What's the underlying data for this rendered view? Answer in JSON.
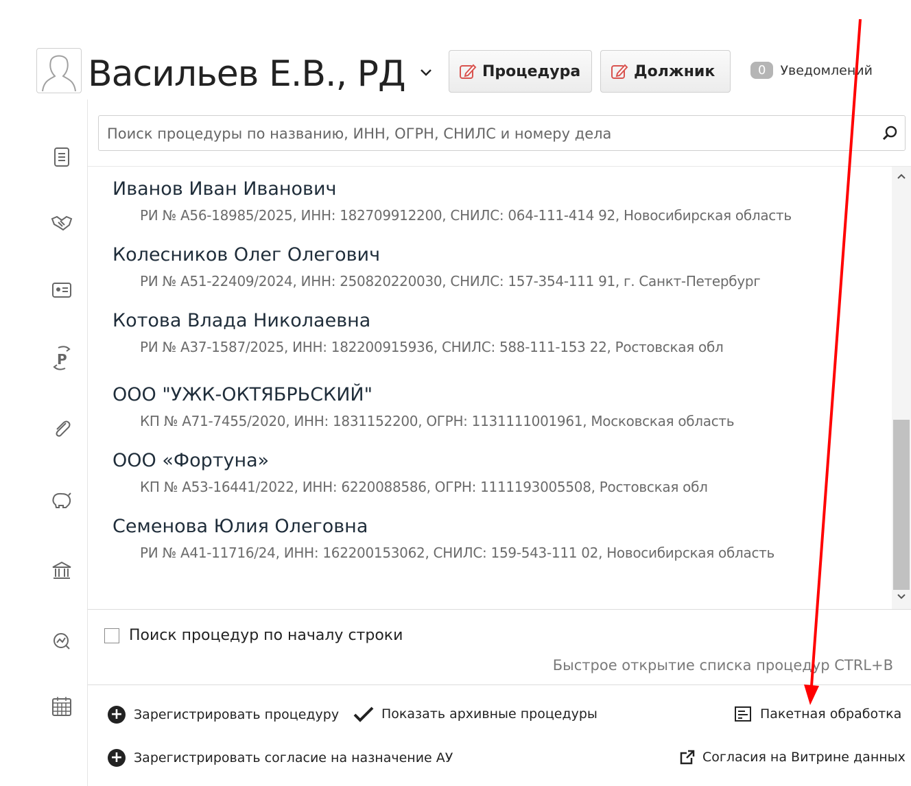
{
  "header": {
    "user_name": "Васильев Е.В., РД",
    "procedure_button": "Процедура",
    "debtor_button": "Должник",
    "notifications_count": "0",
    "notifications_label": "Уведомлений"
  },
  "search": {
    "placeholder": "Поиск процедуры по названию, ИНН, ОГРН, СНИЛС и номеру дела"
  },
  "procedures": [
    {
      "name": "Иванов Иван Иванович",
      "details": "РИ № А56-18985/2025, ИНН: 182709912200, СНИЛС: 064-111-414 92, Новосибирская область"
    },
    {
      "name": "Колесников Олег Олегович",
      "details": "РИ № А51-22409/2024, ИНН: 250820220030, СНИЛС: 157-354-111 91, г. Санкт-Петербург"
    },
    {
      "name": "Котова Влада Николаевна",
      "details": "РИ № А37-1587/2025, ИНН: 182200915936, СНИЛС: 588-111-153 22, Ростовская обл"
    },
    {
      "name": "ООО \"УЖК-ОКТЯБРЬСКИЙ\"",
      "details": "КП № А71-7455/2020, ИНН: 1831152200, ОГРН: 1131111001961, Московская область"
    },
    {
      "name": "ООО «Фортуна»",
      "details": "КП № А53-16441/2022, ИНН: 6220088586, ОГРН: 1111193005508, Ростовская обл"
    },
    {
      "name": "Семенова Юлия Олеговна",
      "details": "РИ № А41-11716/24, ИНН: 162200153062, СНИЛС: 159-543-111 02, Новосибирская область"
    }
  ],
  "options": {
    "search_from_start_label": "Поиск процедур по началу строки",
    "search_from_start_checked": false,
    "quick_open_hint": "Быстрое открытие списка процедур CTRL+B"
  },
  "actions": {
    "register_procedure": "Зарегистрировать процедуру",
    "show_archived": "Показать архивные процедуры",
    "batch_processing": "Пакетная обработка",
    "register_consent": "Зарегистрировать согласие на назначение АУ",
    "data_showcase_consents": "Согласия на Витрине данных"
  },
  "colors": {
    "annotation_arrow": "#ff0000",
    "scroll_thumb": "#c1c1c1",
    "edit_icon": "#d9534f"
  },
  "sidebar_icons": [
    "document-icon",
    "handshake-icon",
    "id-card-icon",
    "ruble-transfer-icon",
    "paperclip-icon",
    "piggy-bank-icon",
    "bank-icon",
    "analytics-icon",
    "calendar-icon"
  ]
}
